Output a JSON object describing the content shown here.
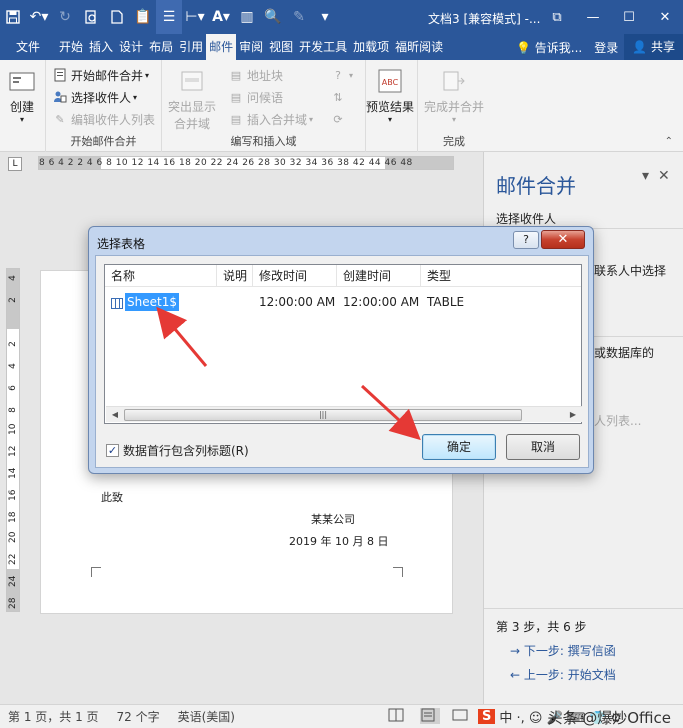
{
  "titlebar": {
    "doc_title": "文档3 [兼容模式] -...",
    "winbtns": [
      "⧉",
      "—",
      "☐",
      "✕"
    ]
  },
  "tabs": {
    "file": "文件",
    "items": [
      "开始",
      "插入",
      "设计",
      "布局",
      "引用",
      "邮件",
      "审阅",
      "视图",
      "开发工具",
      "加载项",
      "福昕阅读"
    ],
    "active": "邮件",
    "tell_me": "告诉我...",
    "login": "登录",
    "share": "共享"
  },
  "ribbon": {
    "create": "创建",
    "start_mail_merge": "开始邮件合并",
    "select_recipients": "选择收件人",
    "edit_recipients": "编辑收件人列表",
    "group_start": "开始邮件合并",
    "highlight_fields_1": "突出显示",
    "highlight_fields_2": "合并域",
    "address_block": "地址块",
    "greeting_line": "问候语",
    "insert_merge_field": "插入合并域",
    "group_write": "编写和插入域",
    "preview_results": "预览结果",
    "preview_icon_text": "ABC",
    "finish_merge": "完成并合并",
    "group_finish": "完成"
  },
  "ruler": {
    "tab_selector": "L",
    "h_numbers": "8  6  4  2     2  4  6  8 10 12 14 16 18 20 22 24 26 28 30 32 34 36 38    42 44 46 48",
    "v_numbers": [
      "4",
      "2",
      "",
      "2",
      "4",
      "6",
      "8",
      "10",
      "12",
      "14",
      "16",
      "18",
      "20",
      "22",
      "24",
      "26",
      "28"
    ]
  },
  "page": {
    "line1": "此致",
    "company": "某某公司",
    "date": "2019 年 10 月 8 日"
  },
  "pane": {
    "title": "邮件合并",
    "select_recipients": "选择收件人",
    "frag1": "联系人中选择",
    "frag2": "或数据库的",
    "frag3": "人列表...",
    "step": "第 3 步，共 6 步",
    "next": "下一步: 撰写信函",
    "prev": "上一步: 开始文档"
  },
  "dialog": {
    "title": "选择表格",
    "help": "?",
    "close": "✕",
    "columns": [
      "名称",
      "说明",
      "修改时间",
      "创建时间",
      "类型"
    ],
    "rows": [
      {
        "name": "Sheet1$",
        "desc": "",
        "modified": "12:00:00 AM",
        "created": "12:00:00 AM",
        "type": "TABLE"
      }
    ],
    "checkbox_label": "数据首行包含列标题(R)",
    "checkbox_checked": true,
    "ok": "确定",
    "cancel": "取消"
  },
  "status": {
    "page": "第 1 页，共 1 页",
    "words": "72 个字",
    "lang": "英语(美国)",
    "ime": "中 ·, ☺ 🎤 ⌨ 👕 ⚙",
    "watermark": "头条 @爆炒Office"
  },
  "colors": {
    "brand": "#2b579a",
    "selection": "#3399ff",
    "arrow": "#e53935"
  }
}
